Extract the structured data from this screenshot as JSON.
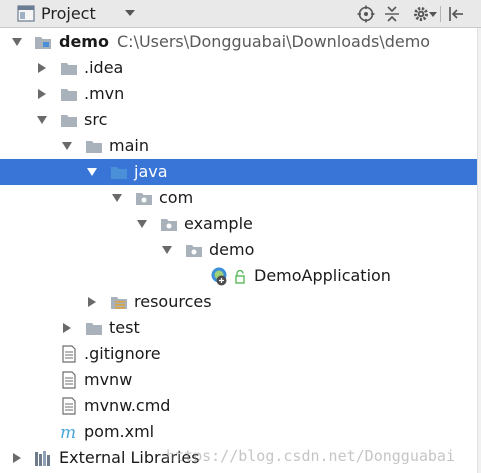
{
  "panel": {
    "title": "Project",
    "actions": [
      "target-icon",
      "collapse-all-icon",
      "gear-icon",
      "hide-panel-icon"
    ]
  },
  "tree": {
    "root_name": "demo",
    "root_path": "C:\\Users\\Dongguabai\\Downloads\\demo",
    "idea": ".idea",
    "mvn": ".mvn",
    "src": "src",
    "main": "main",
    "java": "java",
    "com": "com",
    "example": "example",
    "demo_pkg": "demo",
    "app_class": "DemoApplication",
    "resources": "resources",
    "test": "test",
    "gitignore": ".gitignore",
    "mvnw": "mvnw",
    "mvnw_cmd": "mvnw.cmd",
    "pom": "pom.xml",
    "external_libraries": "External Libraries"
  },
  "selected_item": "java",
  "watermark": "https://blog.csdn.net/Dongguabai",
  "colors": {
    "selection": "#3875d7",
    "folder": "#a9b1ba",
    "source_folder": "#4a90d9",
    "header": "#e9e9e9"
  }
}
